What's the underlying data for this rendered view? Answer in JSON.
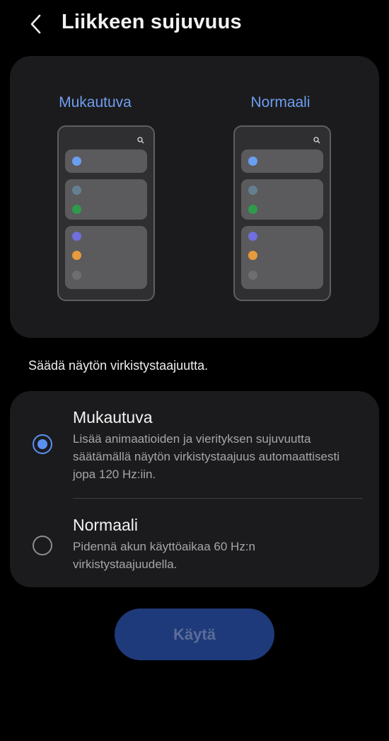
{
  "header": {
    "title": "Liikkeen sujuvuus",
    "back_icon": "chevron-left-icon"
  },
  "preview": {
    "left_label": "Mukautuva",
    "right_label": "Normaali",
    "search_icon": "search-icon",
    "dot_colors": [
      "#6a9ff0",
      "#667f90",
      "#2f9a4a",
      "#6f6fe0",
      "#e89a3c",
      "#6e6e70"
    ]
  },
  "description": "Säädä näytön virkistystaajuutta.",
  "options": [
    {
      "title": "Mukautuva",
      "description": "Lisää animaatioiden ja vierityksen sujuvuutta säätämällä näytön virkistystaajuus automaattisesti jopa 120 Hz:iin.",
      "selected": true
    },
    {
      "title": "Normaali",
      "description": "Pidennä akun käyttöaikaa 60 Hz:n virkistystaajuudella.",
      "selected": false
    }
  ],
  "apply_button": {
    "label": "Käytä",
    "enabled": false
  },
  "colors": {
    "accent": "#5b8ff2",
    "card_bg": "#1b1b1d",
    "apply_bg": "#1f3a7a"
  }
}
